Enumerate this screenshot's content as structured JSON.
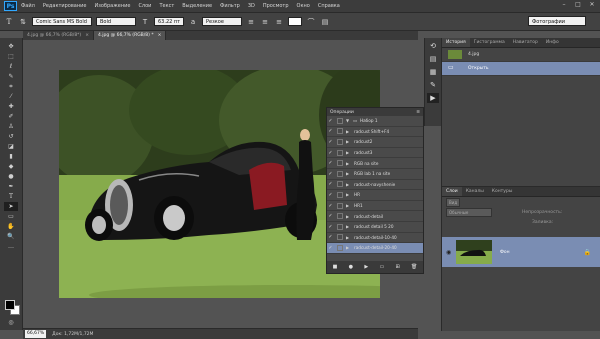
{
  "app": {
    "logo": "Ps"
  },
  "menu": [
    "Файл",
    "Редактирование",
    "Изображение",
    "Слои",
    "Текст",
    "Выделение",
    "Фильтр",
    "3D",
    "Просмотр",
    "Окно",
    "Справка"
  ],
  "options": {
    "tool_icon": "T",
    "font_family": "Comic Sans MS Bold",
    "font_style": "Bold",
    "font_size": "63.22 пт",
    "antialias": "Резкое",
    "workspace": "Фотографии"
  },
  "tabs": [
    {
      "label": "4.jpg @ 66,7% (RGB/8*)",
      "active": false
    },
    {
      "label": "4.jpg @ 66,7% (RGB/8) *",
      "active": true
    }
  ],
  "status": {
    "zoom": "66,67%",
    "doc": "Док: 1,72M/1,72M"
  },
  "history_panel": {
    "tabs": [
      "История",
      "Гистограмма",
      "Навигатор",
      "Инфо"
    ],
    "items": [
      {
        "label": "4.jpg",
        "selected": false
      },
      {
        "label": "Открыть",
        "selected": true
      }
    ]
  },
  "layers_panel": {
    "tabs": [
      "Слои",
      "Каналы",
      "Контуры"
    ],
    "filter_label": "Вид",
    "blend": "Обычные",
    "opacity_label": "Непрозрачность:",
    "fill_label": "Заливка:",
    "layer_name": "Фон"
  },
  "actions_panel": {
    "title": "Операции",
    "items": [
      {
        "label": "Набор 1",
        "checked": true,
        "type": "set"
      },
      {
        "label": "radcust  Shift+F4",
        "checked": true
      },
      {
        "label": "radcust2",
        "checked": true
      },
      {
        "label": "radcust3",
        "checked": true
      },
      {
        "label": "RGB na site",
        "checked": true
      },
      {
        "label": "RGB lab 1 na site",
        "checked": true
      },
      {
        "label": "radcust-navyshenie",
        "checked": true
      },
      {
        "label": "HR",
        "checked": true
      },
      {
        "label": "HR1",
        "checked": true
      },
      {
        "label": "radcust-detail",
        "checked": true
      },
      {
        "label": "radcust detail 5 20",
        "checked": true
      },
      {
        "label": "radcust-detail-10-40",
        "checked": true
      },
      {
        "label": "radcust-detail-20-40",
        "checked": true,
        "selected": true
      }
    ]
  },
  "colors": {
    "foreground": "#000000",
    "background": "#ffffff",
    "selection": "#7a8db3"
  }
}
